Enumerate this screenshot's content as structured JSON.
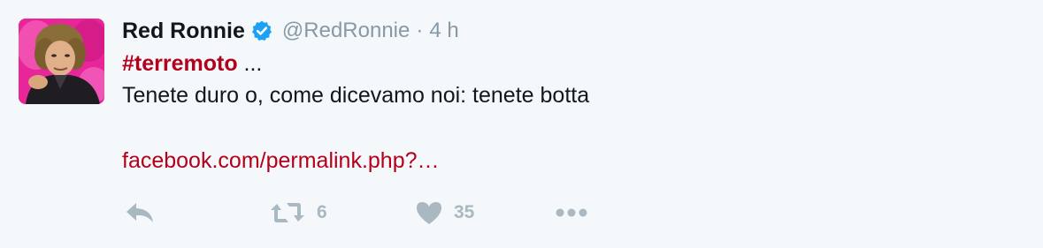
{
  "tweet": {
    "author": {
      "display_name": "Red Ronnie",
      "handle": "@RedRonnie",
      "verified": true,
      "verified_icon": "verified-badge-icon"
    },
    "separator": "·",
    "timestamp": "4 h",
    "hashtag": "#terremoto",
    "hashtag_suffix": " ...",
    "body_line": "Tenete duro o, come dicevamo noi: tenete botta",
    "link_text": "facebook.com/permalink.php?…",
    "actions": {
      "reply": {
        "icon": "reply-icon"
      },
      "retweet": {
        "icon": "retweet-icon",
        "count": "6"
      },
      "like": {
        "icon": "heart-icon",
        "count": "35"
      },
      "more": {
        "icon": "more-icon"
      }
    }
  },
  "colors": {
    "background": "#f5f8fa",
    "text": "#14171a",
    "muted": "#8899a6",
    "accent": "#b3001b",
    "action_gray": "#aab8c2",
    "verified_blue": "#1da1f2"
  }
}
